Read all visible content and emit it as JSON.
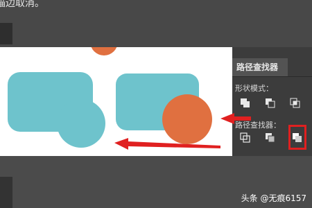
{
  "top_caption": "描边取消。",
  "panel": {
    "title": "路径查找器",
    "shape_modes_label": "形状模式：",
    "pathfinders_label": "路径查找器："
  },
  "watermark": "头条 @无痕6157",
  "colors": {
    "teal": "#6ec3cc",
    "orange": "#e07040",
    "arrow_red": "#e02020",
    "panel_bg": "#3c3c3c"
  },
  "icons": {
    "shape_modes": [
      "unite-icon",
      "minus-front-icon",
      "intersect-icon"
    ],
    "pathfinders": [
      "divide-icon",
      "trim-icon",
      "merge-icon"
    ]
  }
}
